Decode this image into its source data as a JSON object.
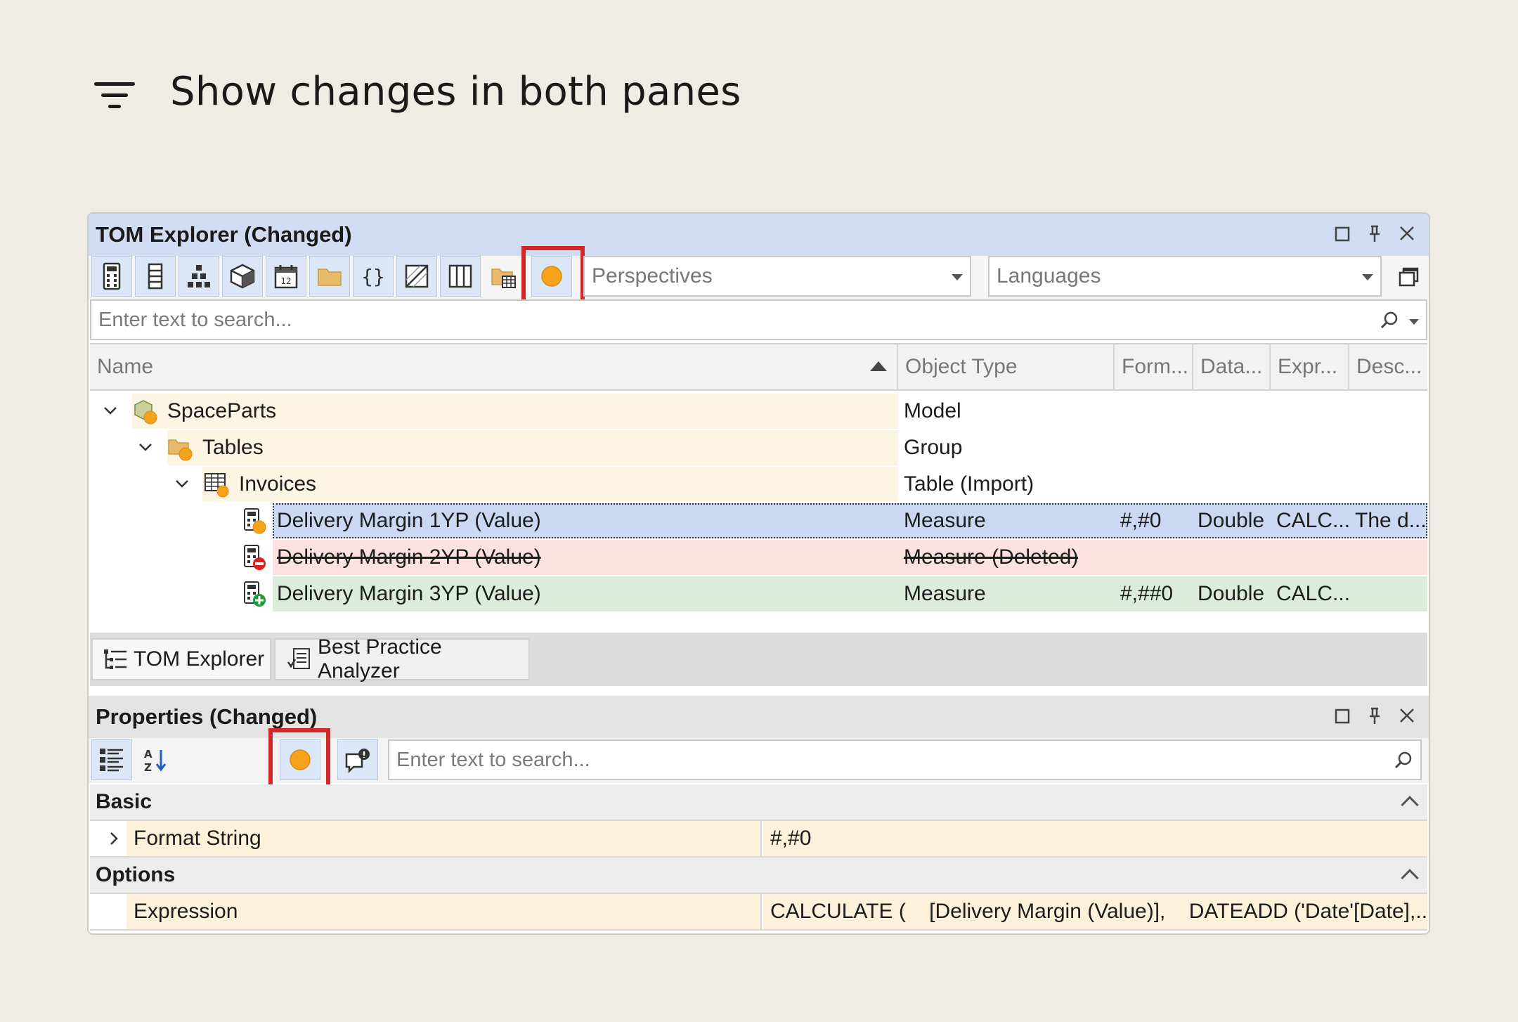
{
  "heading": {
    "title": "Show changes in both panes",
    "icon": "filter-lines-icon"
  },
  "tom_explorer": {
    "title": "TOM Explorer (Changed)",
    "toolbar_icons": [
      "calculator-icon",
      "column-icon",
      "hierarchy-icon",
      "cube-icon",
      "calendar-icon",
      "folder-icon",
      "braces-icon",
      "diagonal-icon",
      "columns-grid-icon",
      "folder-table-icon",
      "changes-indicator-icon"
    ],
    "perspectives": {
      "value": "Perspectives"
    },
    "languages": {
      "value": "Languages"
    },
    "search": {
      "placeholder": "Enter text to search..."
    },
    "columns": [
      "Name",
      "Object Type",
      "Form...",
      "Data...",
      "Expr...",
      "Desc..."
    ],
    "rows": [
      {
        "name": "SpaceParts",
        "type": "Model",
        "format": "",
        "datatype": "",
        "expression": "",
        "description": ""
      },
      {
        "name": "Tables",
        "type": "Group",
        "format": "",
        "datatype": "",
        "expression": "",
        "description": ""
      },
      {
        "name": "Invoices",
        "type": "Table (Import)",
        "format": "",
        "datatype": "",
        "expression": "",
        "description": ""
      },
      {
        "name": "Delivery Margin 1YP (Value)",
        "type": "Measure",
        "format": "#,#0",
        "datatype": "Double",
        "expression": "CALC...",
        "description": "The d...",
        "state": "changed",
        "color": "#cad8f2"
      },
      {
        "name": "Delivery Margin 2YP (Value)",
        "type": "Measure (Deleted)",
        "format": "",
        "datatype": "",
        "expression": "",
        "description": "",
        "state": "deleted",
        "color": "#fde0e0"
      },
      {
        "name": "Delivery Margin 3YP (Value)",
        "type": "Measure",
        "format": "#,##0",
        "datatype": "Double",
        "expression": "CALC...",
        "description": "",
        "state": "added",
        "color": "#dcecdc"
      }
    ],
    "tabs": [
      "TOM Explorer",
      "Best Practice Analyzer"
    ]
  },
  "properties": {
    "title": "Properties (Changed)",
    "search": {
      "placeholder": "Enter text to search..."
    },
    "sections": [
      {
        "name": "Basic",
        "rows": [
          {
            "name": "Format String",
            "value": "#,#0"
          }
        ]
      },
      {
        "name": "Options",
        "rows": [
          {
            "name": "Expression",
            "value": "CALCULATE (    [Delivery Margin (Value)],    DATEADD ('Date'[Date],..."
          }
        ]
      }
    ]
  },
  "colors": {
    "highlight": "#d3282a",
    "change_dot": "#f7a21b",
    "title_bar": "#cfdcf2",
    "properties_title": "#e3e3e3"
  }
}
